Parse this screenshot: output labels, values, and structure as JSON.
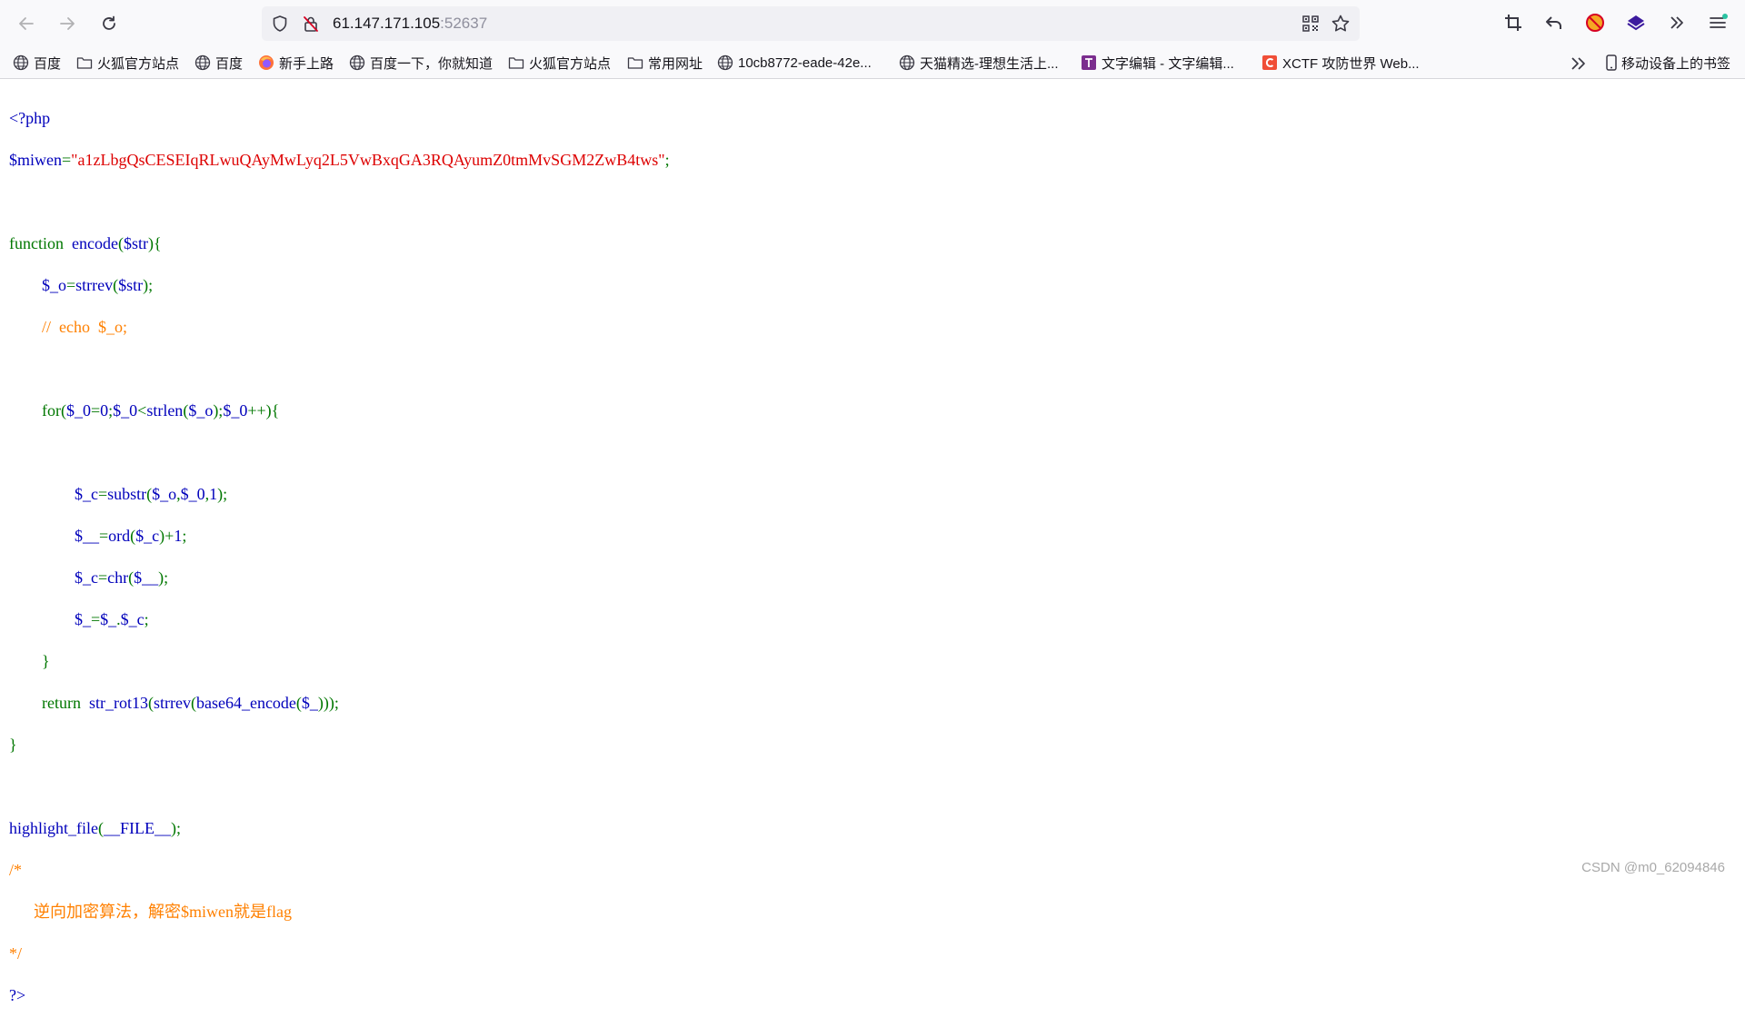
{
  "browser": {
    "url_host": "61.147.171.105",
    "url_port": ":52637"
  },
  "bookmarks": {
    "items": [
      {
        "label": "百度",
        "icon": "globe-icon"
      },
      {
        "label": "火狐官方站点",
        "icon": "folder-icon"
      },
      {
        "label": "百度",
        "icon": "globe-icon"
      },
      {
        "label": "新手上路",
        "icon": "firefox-icon"
      },
      {
        "label": "百度一下，你就知道",
        "icon": "globe-icon"
      },
      {
        "label": "火狐官方站点",
        "icon": "folder-icon"
      },
      {
        "label": "常用网址",
        "icon": "folder-icon"
      },
      {
        "label": "10cb8772-eade-42e...",
        "icon": "globe-icon"
      },
      {
        "label": "天猫精选-理想生活上...",
        "icon": "globe-icon"
      },
      {
        "label": "文字编辑 - 文字编辑...",
        "icon": "text-editor-icon"
      },
      {
        "label": "XCTF 攻防世界 Web...",
        "icon": "xctf-icon"
      }
    ],
    "mobile_label": "移动设备上的书签"
  },
  "code": {
    "line1": "<?php",
    "line2_var": "$miwen",
    "line2_eq": "=",
    "line2_str": "\"a1zLbgQsCESEIqRLwuQAyMwLyq2L5VwBxqGA3RQAyumZ0tmMvSGM2ZwB4tws\"",
    "line2_end": ";",
    "line4_kw": "function",
    "line4_name": "encode",
    "line4_p1": "(",
    "line4_arg": "$str",
    "line4_p2": "){",
    "line5_indent": "        ",
    "line5_a": "$_o",
    "line5_eq": "=",
    "line5_fn": "strrev",
    "line5_p1": "(",
    "line5_arg": "$str",
    "line5_p2": ");",
    "line6_indent": "        ",
    "line6_cmt": "//  echo  $_o;",
    "line8_indent": "        ",
    "line8_for": "for(",
    "line8_a": "$_0",
    "line8_b": "=",
    "line8_c": "0",
    "line8_d": ";",
    "line8_e": "$_0",
    "line8_f": "<",
    "line8_g": "strlen",
    "line8_h": "(",
    "line8_i": "$_o",
    "line8_j": ");",
    "line8_k": "$_0",
    "line8_l": "++){",
    "line10_indent": "                ",
    "line10_a": "$_c",
    "line10_b": "=",
    "line10_c": "substr",
    "line10_d": "(",
    "line10_e": "$_o",
    "line10_f": ",",
    "line10_g": "$_0",
    "line10_h": ",",
    "line10_i": "1",
    "line10_j": ");",
    "line11_indent": "                ",
    "line11_a": "$__",
    "line11_b": "=",
    "line11_c": "ord",
    "line11_d": "(",
    "line11_e": "$_c",
    "line11_f": ")+",
    "line11_g": "1",
    "line11_h": ";",
    "line12_indent": "                ",
    "line12_a": "$_c",
    "line12_b": "=",
    "line12_c": "chr",
    "line12_d": "(",
    "line12_e": "$__",
    "line12_f": ");",
    "line13_indent": "                ",
    "line13_a": "$_",
    "line13_b": "=",
    "line13_c": "$_",
    "line13_d": ".",
    "line13_e": "$_c",
    "line13_f": ";",
    "line14_indent": "        ",
    "line14": "}",
    "line15_indent": "        ",
    "line15_ret": "return",
    "line15_sp": "  ",
    "line15_a": "str_rot13",
    "line15_b": "(",
    "line15_c": "strrev",
    "line15_d": "(",
    "line15_e": "base64_encode",
    "line15_f": "(",
    "line15_g": "$_",
    "line15_h": ")));",
    "line16": "}",
    "line18_a": "highlight_file",
    "line18_b": "(",
    "line18_c": "__FILE__",
    "line18_d": ");",
    "line19": "/*",
    "line20": "      逆向加密算法，解密$miwen就是flag",
    "line21": "*/",
    "line22": "?>"
  },
  "watermark": "CSDN @m0_62094846"
}
